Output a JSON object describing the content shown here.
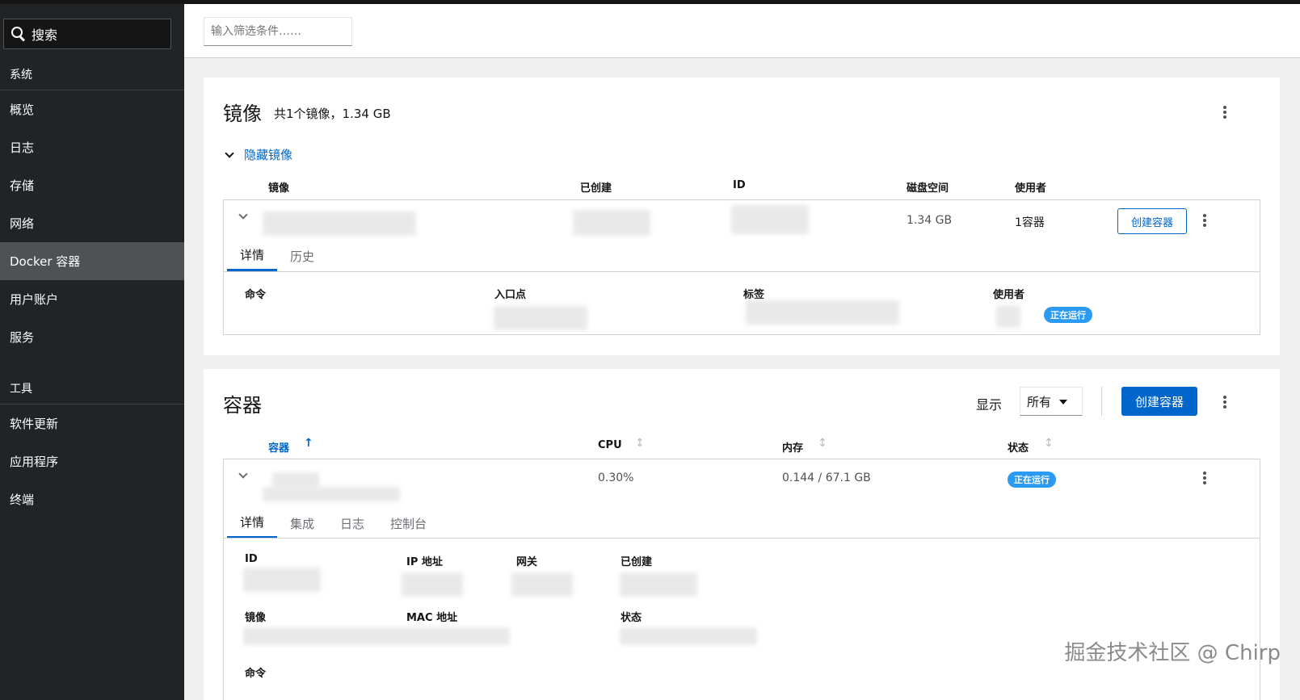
{
  "sidebar": {
    "search_label": "搜索",
    "items": [
      {
        "label": "系统",
        "type": "section"
      },
      {
        "label": "概览"
      },
      {
        "label": "日志"
      },
      {
        "label": "存储"
      },
      {
        "label": "网络"
      },
      {
        "label": "Docker 容器",
        "active": true
      },
      {
        "label": "用户账户"
      },
      {
        "label": "服务"
      },
      {
        "label": "工具",
        "type": "section"
      },
      {
        "label": "软件更新"
      },
      {
        "label": "应用程序"
      },
      {
        "label": "终端"
      }
    ]
  },
  "filter": {
    "placeholder": "输入筛选条件……"
  },
  "images": {
    "title": "镜像",
    "summary": "共1个镜像，1.34 GB",
    "toggle": "隐藏镜像",
    "headers": {
      "image": "镜像",
      "created": "已创建",
      "id": "ID",
      "disk": "磁盘空间",
      "used_by": "使用者"
    },
    "row": {
      "disk": "1.34 GB",
      "used_by": "1容器",
      "create_button": "创建容器"
    },
    "tabs": [
      "详情",
      "历史"
    ],
    "details": {
      "command": "命令",
      "entrypoint": "入口点",
      "tags": "标签",
      "used_by": "使用者",
      "status_badge": "正在运行"
    }
  },
  "containers": {
    "title": "容器",
    "show_label": "显示",
    "show_value": "所有",
    "create_button": "创建容器",
    "headers": {
      "container": "容器",
      "cpu": "CPU",
      "memory": "内存",
      "state": "状态"
    },
    "row": {
      "cpu": "0.30%",
      "memory": "0.144 / 67.1 GB",
      "state_badge": "正在运行"
    },
    "tabs": [
      "详情",
      "集成",
      "日志",
      "控制台"
    ],
    "details": {
      "id": "ID",
      "ip": "IP 地址",
      "gateway": "网关",
      "created": "已创建",
      "image": "镜像",
      "mac": "MAC 地址",
      "state": "状态",
      "command": "命令"
    }
  },
  "watermark": "掘金技术社区 @ Chirp",
  "colors": {
    "accent": "#0066cc",
    "badge": "#2b9af3",
    "sidebar_bg": "#212427",
    "sidebar_active": "#4f5255"
  }
}
